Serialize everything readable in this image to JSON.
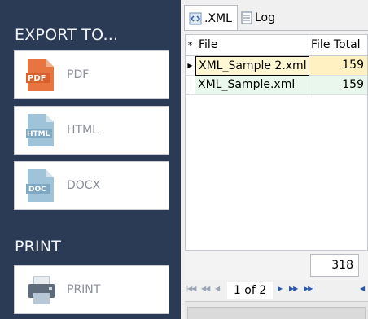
{
  "export": {
    "heading": "EXPORT TO...",
    "buttons": [
      {
        "label": "PDF",
        "icon": "pdf-file-icon",
        "icon_text": "PDF",
        "color": "#e06c3c"
      },
      {
        "label": "HTML",
        "icon": "html-file-icon",
        "icon_text": "HTML",
        "color": "#8fb8d0"
      },
      {
        "label": "DOCX",
        "icon": "docx-file-icon",
        "icon_text": "DOC",
        "color": "#8fb8d0"
      }
    ]
  },
  "print": {
    "heading": "PRINT",
    "button_label": "PRINT",
    "icon": "printer-icon"
  },
  "tabs": [
    {
      "label": ".XML",
      "icon": "xml-icon",
      "active": true
    },
    {
      "label": "Log",
      "icon": "log-icon",
      "active": false
    }
  ],
  "grid": {
    "indicator_header": "*",
    "columns": [
      "File",
      "File Total"
    ],
    "rows": [
      {
        "file": "XML_Sample 2.xml",
        "total": "159",
        "current": true
      },
      {
        "file": "XML_Sample.xml",
        "total": "159",
        "current": false
      }
    ],
    "summary_total": "318"
  },
  "pager": {
    "text": "1 of 2"
  },
  "colors": {
    "panel_bg": "#2b3a55",
    "selected_row": "#fff7d1",
    "alt_row": "#e9f7ec",
    "pager_active": "#2b56a8"
  }
}
